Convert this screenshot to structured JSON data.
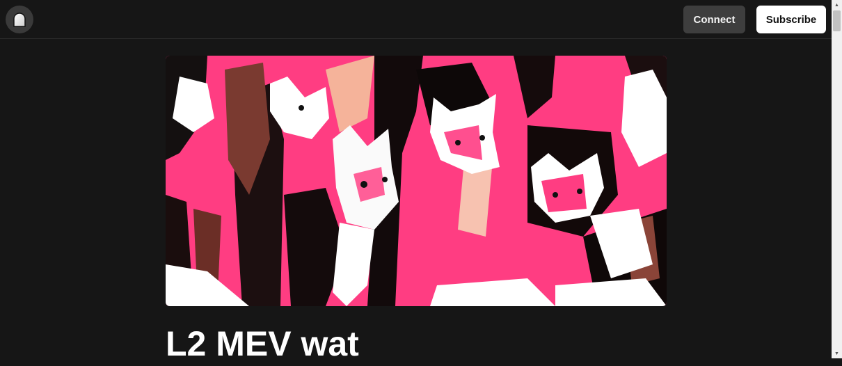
{
  "header": {
    "logo_icon": "mirror-arch-logo-icon",
    "connect_label": "Connect",
    "subscribe_label": "Subscribe"
  },
  "article": {
    "cover_image": "abstract-pink-cats-illustration",
    "title": "L2 MEV wat"
  },
  "colors": {
    "background": "#161616",
    "accent_pink": "#ff3d82",
    "connect_bg": "#3e3e3e",
    "subscribe_bg": "#ffffff"
  }
}
